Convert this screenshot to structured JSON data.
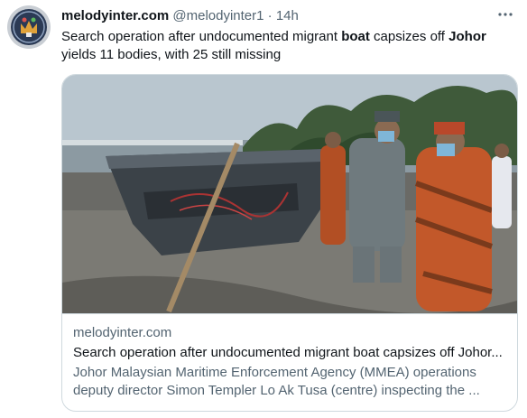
{
  "tweet": {
    "display_name": "melodyinter.com",
    "handle": "@melodyinter1",
    "separator": "·",
    "time": "14h",
    "more_icon": "more-horizontal-icon",
    "text_parts": {
      "p1": "Search operation after undocumented migrant ",
      "bold1": "boat",
      "p2": " capsizes off ",
      "bold2": "Johor",
      "p3": " yields 11 bodies, with 25 still missing"
    }
  },
  "card": {
    "domain": "melodyinter.com",
    "title": "Search operation after undocumented migrant boat capsizes off Johor...",
    "description": "Johor Malaysian Maritime Enforcement Agency (MMEA) operations deputy director Simon Templer Lo Ak Tusa (centre) inspecting the ..."
  },
  "colors": {
    "text_primary": "#0f1419",
    "text_secondary": "#536471",
    "border": "#cfd9de"
  }
}
